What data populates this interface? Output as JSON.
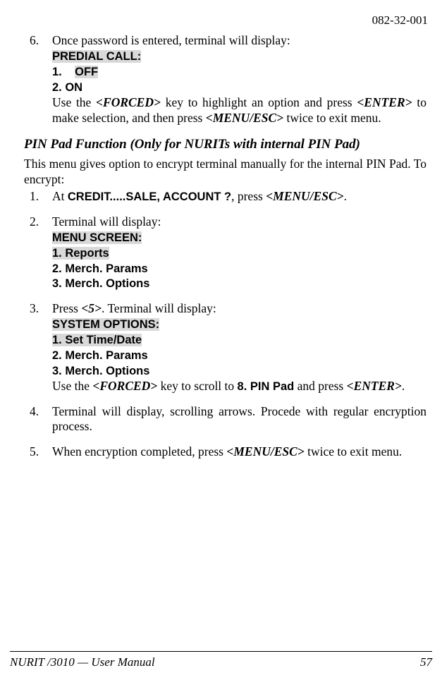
{
  "doc_id": "082-32-001",
  "item6": {
    "num": "6.",
    "intro": "Once password is entered, terminal will display:",
    "hl_title": "PREDIAL CALL:",
    "line1_a": "1.",
    "line1_b": "OFF",
    "line2": "2.    ON",
    "para_a": "Use the  ",
    "forced": "<FORCED>",
    "para_b": "  key  to  highlight  an  option  and  press ",
    "enter": "<ENTER>",
    "para_c": " to  make  selection,  and  then  press   ",
    "menuesc": "<MENU/ESC>",
    "para_d": " twice to exit menu."
  },
  "heading": "PIN Pad Function (Only for NURITs with internal PIN Pad)",
  "intro": "This menu gives option to encrypt terminal manually for the internal PIN Pad.  To encrypt:",
  "pp1": {
    "num": "1.",
    "a": "At  ",
    "credit": "CREDIT.....SALE, ACCOUNT ?",
    "b": ", press ",
    "menuesc": "<MENU/ESC>",
    "c": "."
  },
  "pp2": {
    "num": "2.",
    "intro": "Terminal will display:",
    "hl_title": "MENU SCREEN:",
    "hl_l1": "1.    Reports",
    "l2": "2.    Merch. Params",
    "l3": "3.    Merch. Options"
  },
  "pp3": {
    "num": "3.",
    "a": "Press ",
    "key5": "<5>",
    "b": ". Terminal will display:",
    "hl_title": "SYSTEM OPTIONS:",
    "hl_l1": "1.    Set Time/Date",
    "l2": "2.    Merch. Params",
    "l3": "3.    Merch. Options",
    "para_a": "Use the  ",
    "forced": "<FORCED>",
    "para_b": " key  to  scroll  to   ",
    "pin": "8.  PIN  Pad",
    "para_c": "    and  press ",
    "enter": "<ENTER>",
    "para_d": "."
  },
  "pp4": {
    "num": "4.",
    "text": "Terminal  will  display,    scrolling  arrows.    Procede  with  regular encryption process."
  },
  "pp5": {
    "num": "5.",
    "a": "When encryption completed, press ",
    "menuesc": "<MENU/ESC>",
    "b": " twice to exit menu."
  },
  "footer": {
    "left": "NURIT /3010 — User Manual",
    "right": "57"
  }
}
